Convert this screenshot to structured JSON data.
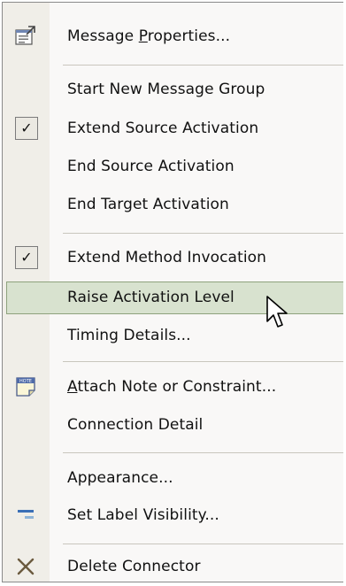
{
  "menu": {
    "items": [
      {
        "label": "Message Properties...",
        "icon": "properties-icon"
      },
      {
        "label": "Start New Message Group"
      },
      {
        "label": "Extend Source Activation",
        "checked": true
      },
      {
        "label": "End Source Activation"
      },
      {
        "label": "End Target Activation"
      },
      {
        "label": "Extend Method Invocation",
        "checked": true
      },
      {
        "label": "Raise Activation Level",
        "highlighted": true
      },
      {
        "label": "Timing Details..."
      },
      {
        "label": "Attach Note or Constraint...",
        "icon": "note-icon"
      },
      {
        "label": "Connection Detail"
      },
      {
        "label": "Appearance..."
      },
      {
        "label": "Set Label Visibility...",
        "icon": "label-visibility-icon"
      },
      {
        "label": "Delete Connector",
        "icon": "delete-icon"
      }
    ],
    "check_mark": "✓",
    "mnemonics": {
      "message_properties": {
        "before": "Message ",
        "key": "P",
        "after": "roperties..."
      },
      "attach_note": {
        "before": "",
        "key": "A",
        "after": "ttach Note or Constraint..."
      }
    }
  },
  "icon_note_text": "HOTE",
  "colors": {
    "menu_bg": "#f9f8f7",
    "gutter_bg": "#f0eee8",
    "highlight_bg": "#d8e2cf",
    "highlight_border": "#8ea27d",
    "separator": "#c9c6bd"
  }
}
